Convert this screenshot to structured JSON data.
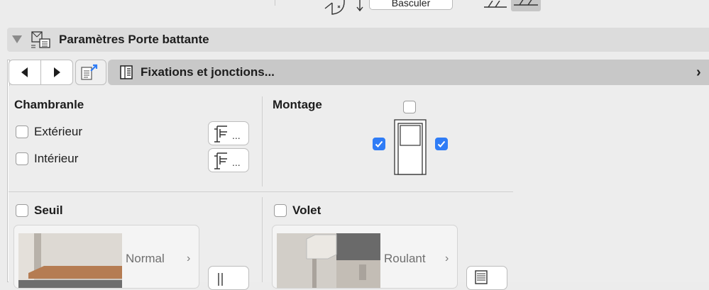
{
  "toolbar": {
    "button_label": "Basculer"
  },
  "section": {
    "title": "Paramètres Porte battante"
  },
  "pager": {
    "label": "Fixations et jonctions...",
    "chevron": "›"
  },
  "chambranle": {
    "title": "Chambranle",
    "options": [
      {
        "label": "Extérieur",
        "checked": false
      },
      {
        "label": "Intérieur",
        "checked": false
      }
    ],
    "more_label": "..."
  },
  "montage": {
    "title": "Montage",
    "top_checked": false,
    "left_checked": true,
    "right_checked": true
  },
  "seuil": {
    "title": "Seuil",
    "checked": false,
    "value": "Normal",
    "chevron": "›"
  },
  "volet": {
    "title": "Volet",
    "checked": false,
    "value": "Roulant",
    "chevron": "›"
  },
  "colors": {
    "accent": "#2f7cf6",
    "header": "#dcdcdc",
    "dropdown": "#c8c8c8"
  },
  "icons": [
    "door-swing-icon",
    "arrow-icons",
    "wall-section-icon",
    "wall-section-selected-icon",
    "disclosure-triangle-icon",
    "window-door-settings-icon",
    "chevron-left-icon",
    "chevron-right-icon",
    "upload-icon",
    "panel-icon",
    "frame-profile-icon",
    "door-preview-icon",
    "threshold-preview-icon",
    "shutter-preview-icon",
    "list-icon"
  ]
}
